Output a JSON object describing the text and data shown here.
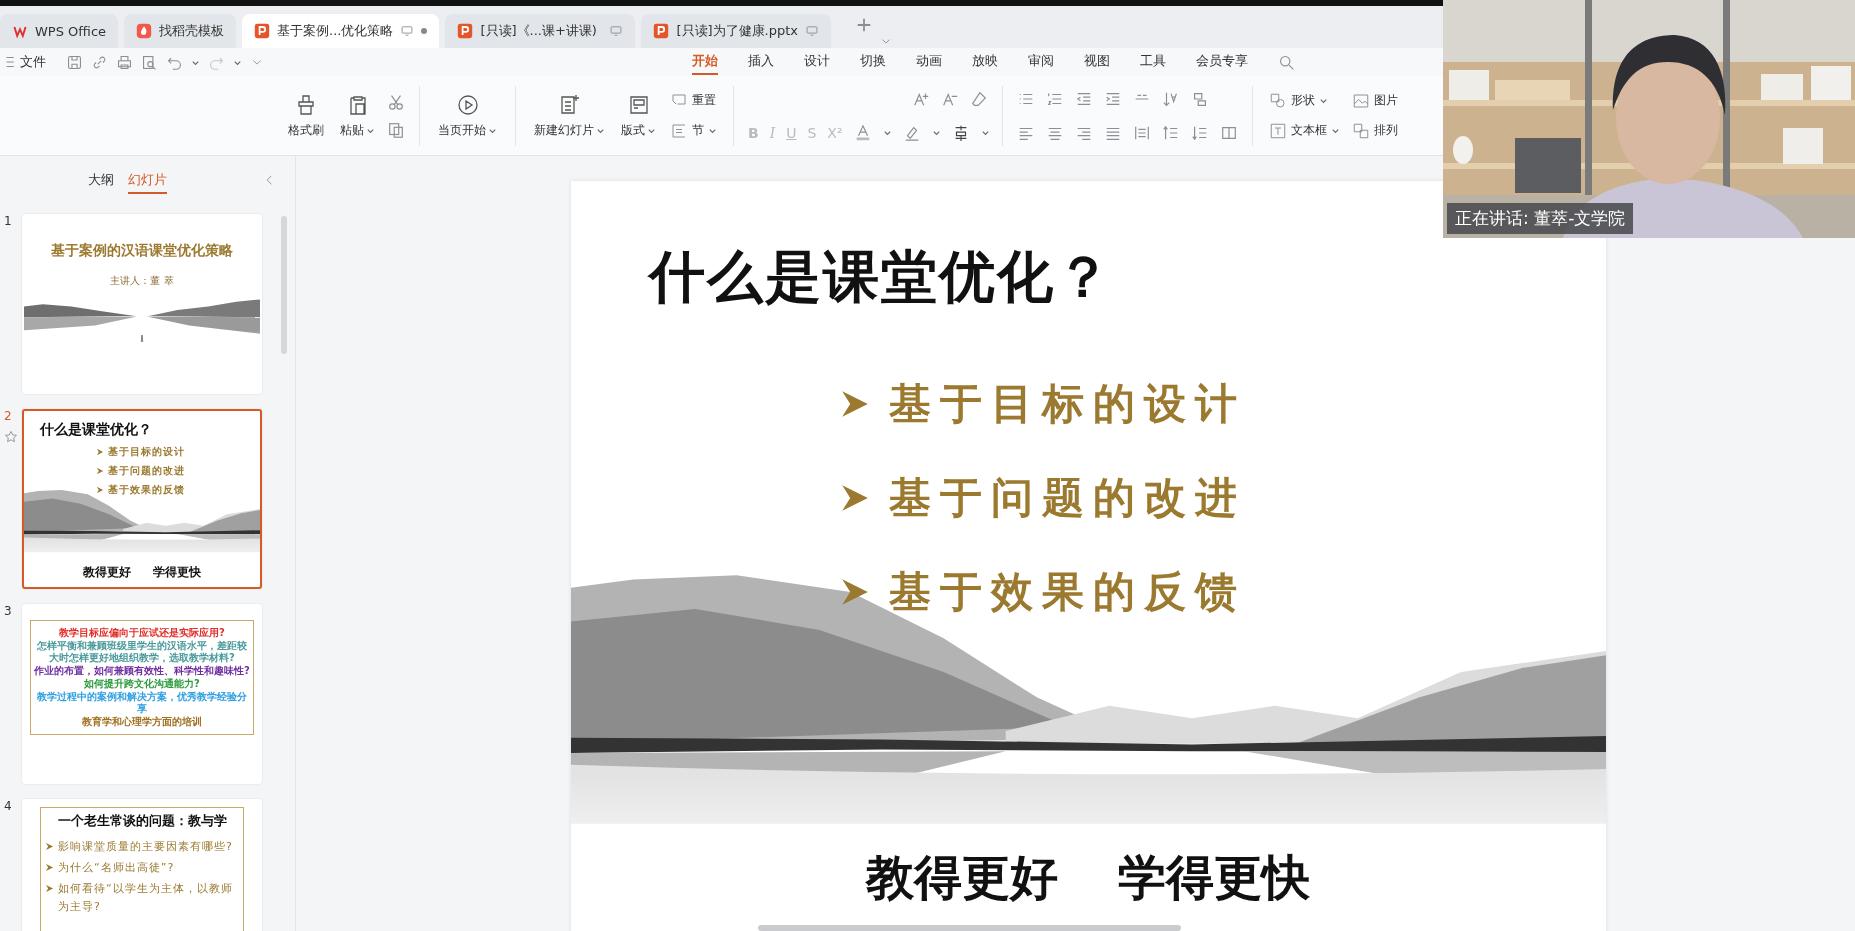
{
  "tabs": [
    {
      "kind": "home",
      "label": "WPS Office",
      "selected": false,
      "modified": false
    },
    {
      "kind": "template",
      "label": "找稻壳模板",
      "selected": false,
      "modified": false
    },
    {
      "kind": "doc",
      "label": "基于案例...优化策略",
      "selected": true,
      "modified": true
    },
    {
      "kind": "doc",
      "label": "[只读]《...课+讲课)",
      "selected": false,
      "modified": false
    },
    {
      "kind": "doc",
      "label": "[只读]为了健康.pptx",
      "selected": false,
      "modified": false
    }
  ],
  "quick_bar": {
    "file": "文件"
  },
  "menu": [
    {
      "label": "开始",
      "selected": true
    },
    {
      "label": "插入",
      "selected": false
    },
    {
      "label": "设计",
      "selected": false
    },
    {
      "label": "切换",
      "selected": false
    },
    {
      "label": "动画",
      "selected": false
    },
    {
      "label": "放映",
      "selected": false
    },
    {
      "label": "审阅",
      "selected": false
    },
    {
      "label": "视图",
      "selected": false
    },
    {
      "label": "工具",
      "selected": false
    },
    {
      "label": "会员专享",
      "selected": false
    }
  ],
  "ribbon": {
    "clipboard": [
      {
        "label": "格式刷",
        "dropdown": false
      },
      {
        "label": "粘贴",
        "dropdown": true
      }
    ],
    "play": {
      "label": "当页开始",
      "dropdown": true
    },
    "slides": [
      {
        "label": "新建幻灯片",
        "dropdown": true
      },
      {
        "label": "版式",
        "dropdown": true
      }
    ],
    "small": [
      {
        "label": "重置",
        "dropdown": false
      },
      {
        "label": "节",
        "dropdown": true
      }
    ],
    "font_buttons": [
      {
        "label": "B",
        "kind": "bold",
        "disabled": true
      },
      {
        "label": "I",
        "kind": "italic",
        "disabled": true
      },
      {
        "label": "U",
        "kind": "underline",
        "disabled": true
      },
      {
        "label": "S",
        "kind": "plain",
        "disabled": true
      },
      {
        "label": "X²",
        "kind": "plain",
        "disabled": true
      }
    ],
    "insert": [
      {
        "label": "形状",
        "dropdown": true
      },
      {
        "label": "文本框",
        "dropdown": true
      },
      {
        "label": "图片",
        "dropdown": false
      },
      {
        "label": "排列",
        "dropdown": false
      }
    ]
  },
  "panel_tabs": [
    {
      "label": "大纲",
      "selected": false
    },
    {
      "label": "幻灯片",
      "selected": true
    }
  ],
  "slides": [
    {
      "number": "1",
      "selected": false,
      "animated": false,
      "kind": "title",
      "title": "基于案例的汉语课堂优化策略",
      "subtitle": "主讲人：董 萃"
    },
    {
      "number": "2",
      "selected": true,
      "animated": true,
      "kind": "bullets",
      "title": "什么是课堂优化？",
      "bullets": [
        "基于目标的设计",
        "基于问题的改进",
        "基于效果的反馈"
      ],
      "footer": [
        "教得更好",
        "学得更快"
      ]
    },
    {
      "number": "3",
      "selected": false,
      "animated": false,
      "kind": "questions",
      "lines": [
        {
          "text": "教学目标应偏向于应试还是实际应用?",
          "color": "#e0302a"
        },
        {
          "text": "怎样平衡和兼顾班级里学生的汉语水平，差距较大时怎样更好地组织教学，选取教学材料?",
          "color": "#4a9a9a"
        },
        {
          "text": "作业的布置，如何兼顾有效性、科学性和趣味性?",
          "color": "#7030a0"
        },
        {
          "text": "如何提升跨文化沟通能力?",
          "color": "#2a9a3a"
        },
        {
          "text": "教学过程中的案例和解决方案，优秀教学经验分享",
          "color": "#30a0e0"
        },
        {
          "text": "教育学和心理学方面的培训",
          "color": "#a07020"
        }
      ]
    },
    {
      "number": "4",
      "selected": false,
      "animated": false,
      "kind": "outline",
      "title": "一个老生常谈的问题：教与学",
      "bullets": [
        "影响课堂质量的主要因素有哪些?",
        "为什么“名师出高徒”?",
        "如何看待“以学生为主体，以教师为主导?"
      ]
    }
  ],
  "slide": {
    "title": "什么是课堂优化？",
    "bullets": [
      "基于目标的设计",
      "基于问题的改进",
      "基于效果的反馈"
    ],
    "footer": [
      "教得更好",
      "学得更快"
    ]
  },
  "video": {
    "speaker_label": "正在讲话: 董萃-文学院"
  }
}
